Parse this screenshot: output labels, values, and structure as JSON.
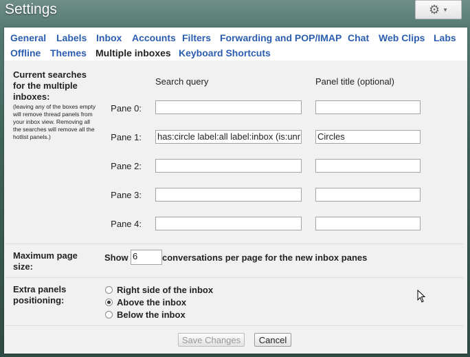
{
  "header": {
    "title": "Settings"
  },
  "tabs": [
    {
      "label": "General"
    },
    {
      "label": "Labels"
    },
    {
      "label": "Inbox"
    },
    {
      "label": "Accounts"
    },
    {
      "label": "Filters"
    },
    {
      "label": "Forwarding and POP/IMAP"
    },
    {
      "label": "Chat"
    },
    {
      "label": "Web Clips"
    },
    {
      "label": "Labs"
    },
    {
      "label": "Offline"
    },
    {
      "label": "Themes"
    },
    {
      "label": "Multiple inboxes"
    },
    {
      "label": "Keyboard Shortcuts"
    }
  ],
  "searches": {
    "title": "Current searches for the multiple inboxes:",
    "note": "(leaving any of the boxes empty will remove thread panels from your inbox view. Removing all the searches will remove all the hotlist panels.)",
    "col_query": "Search query",
    "col_title": "Panel title (optional)",
    "panes": [
      {
        "label": "Pane 0:",
        "query": "",
        "title": ""
      },
      {
        "label": "Pane 1:",
        "query": "has:circle label:all label:inbox (is:unr",
        "title": "Circles"
      },
      {
        "label": "Pane 2:",
        "query": "",
        "title": ""
      },
      {
        "label": "Pane 3:",
        "query": "",
        "title": ""
      },
      {
        "label": "Pane 4:",
        "query": "",
        "title": ""
      }
    ]
  },
  "page_size": {
    "title": "Maximum page size:",
    "show": "Show",
    "value": "6",
    "suffix": "conversations per page for the new inbox panes"
  },
  "positioning": {
    "title": "Extra panels positioning:",
    "options": [
      {
        "label": "Right side of the inbox",
        "selected": false
      },
      {
        "label": "Above the inbox",
        "selected": true
      },
      {
        "label": "Below the inbox",
        "selected": false
      }
    ]
  },
  "buttons": {
    "save": "Save Changes",
    "cancel": "Cancel"
  }
}
